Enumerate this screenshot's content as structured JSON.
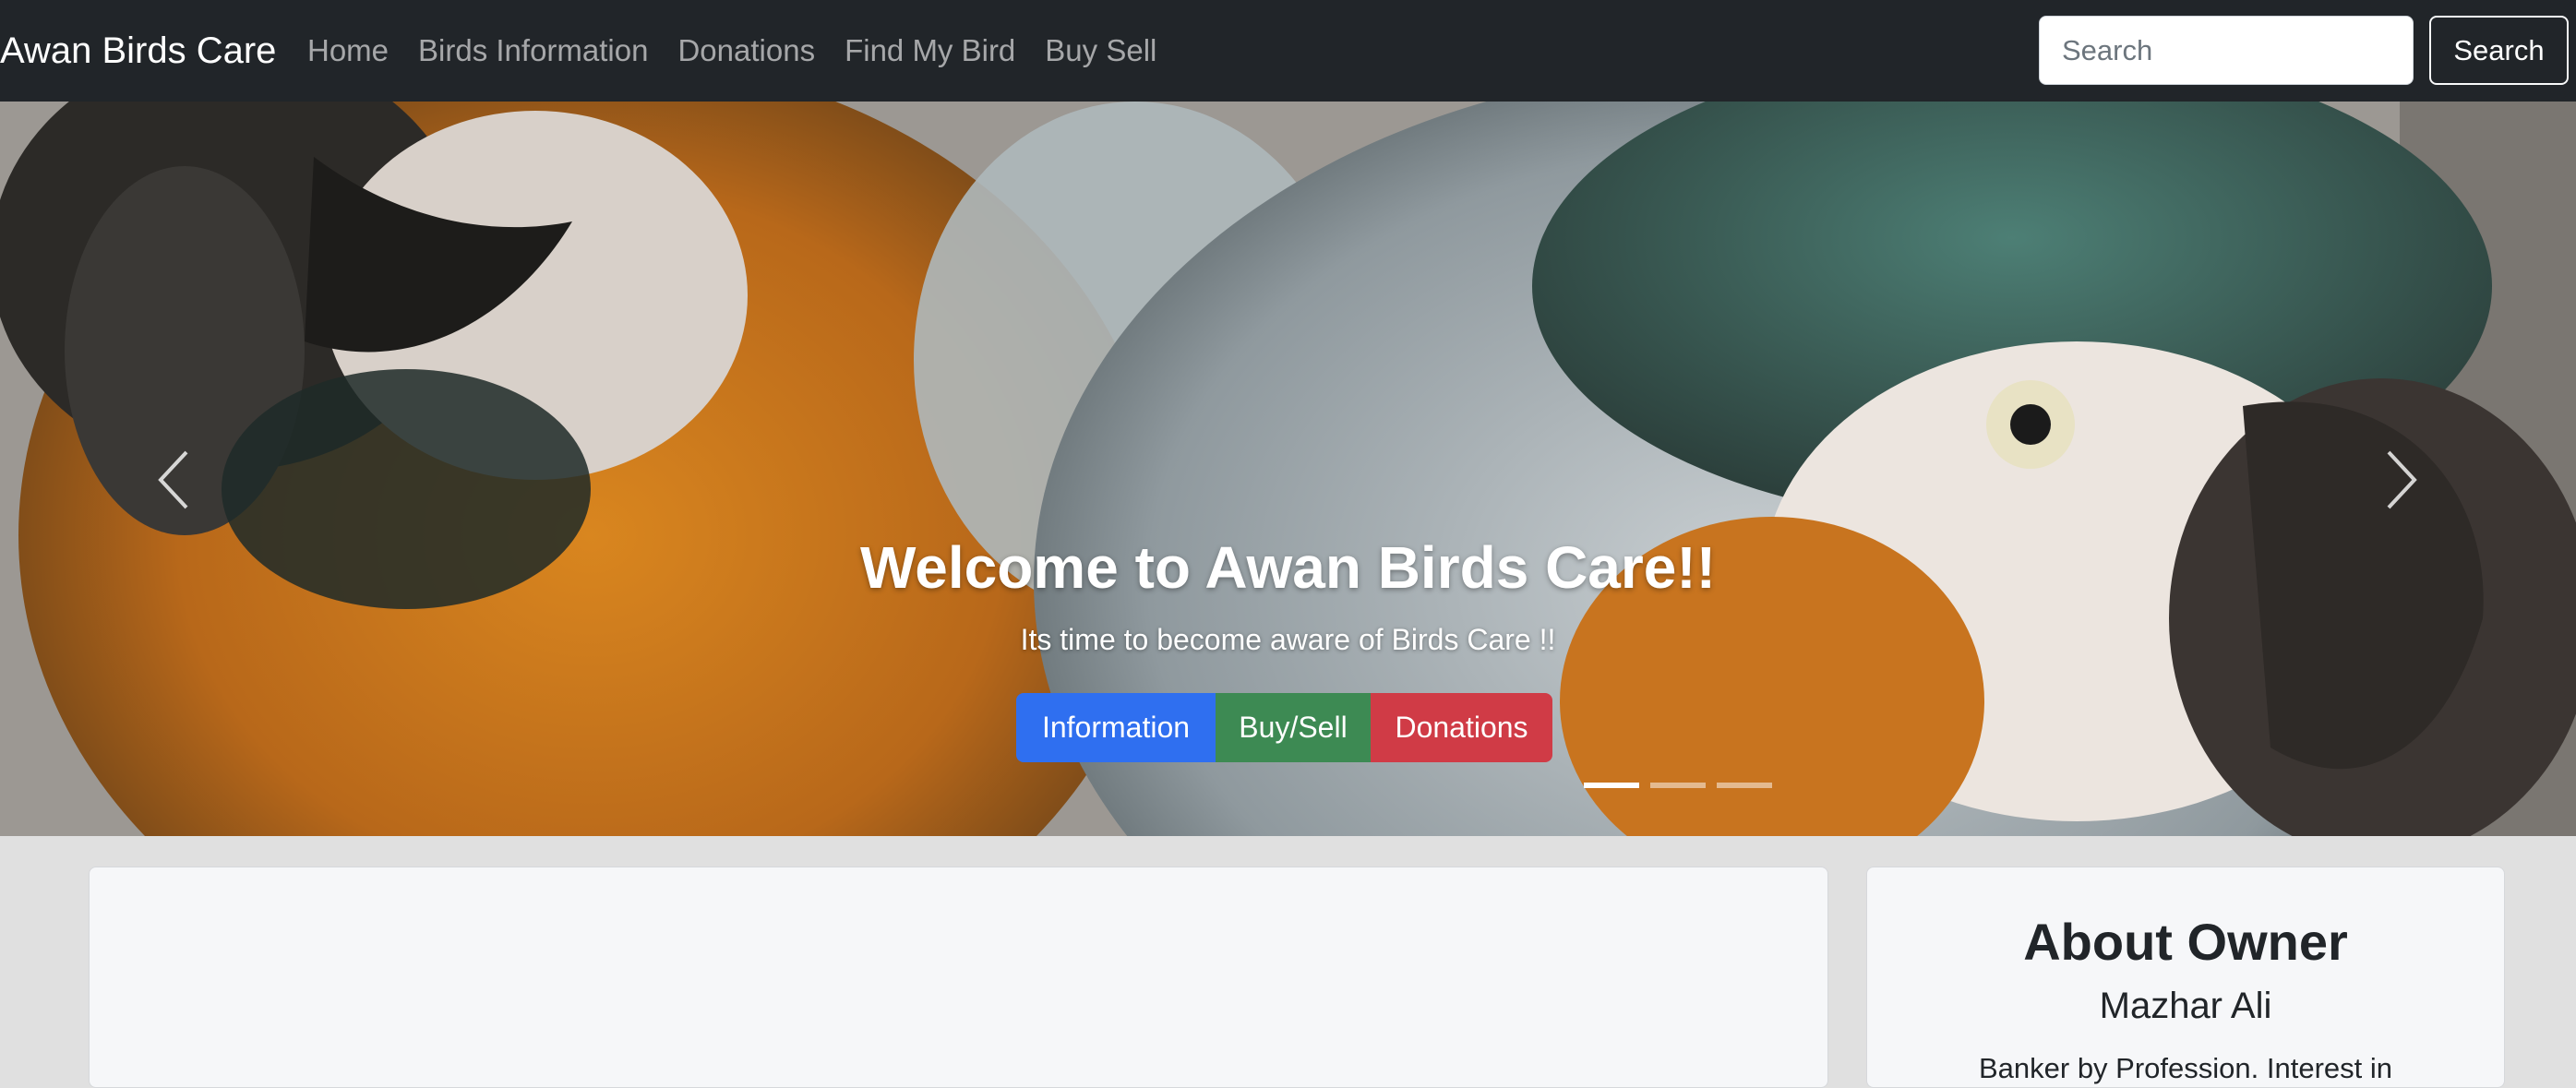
{
  "navbar": {
    "brand": "Awan Birds Care",
    "links": [
      "Home",
      "Birds Information",
      "Donations",
      "Find My Bird",
      "Buy Sell"
    ],
    "search_placeholder": "Search",
    "search_button": "Search"
  },
  "hero": {
    "title": "Welcome to Awan Birds Care!!",
    "subtitle": "Its time to become aware of Birds Care !!",
    "buttons": {
      "information": "Information",
      "buy_sell": "Buy/Sell",
      "donations": "Donations"
    },
    "indicators": {
      "total": 3,
      "active": 1
    }
  },
  "about": {
    "title": "About Owner",
    "name": "Mazhar Ali",
    "bio": "Banker by Profession. Interest in"
  },
  "colors": {
    "navbar_bg": "#212529",
    "info_button": "#2f6ff0",
    "buy_button": "#3d8a53",
    "donations_button": "#d03b46",
    "page_bg": "#e0e0e0"
  }
}
